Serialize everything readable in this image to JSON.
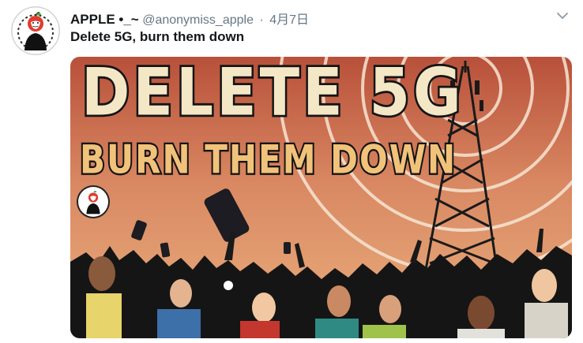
{
  "tweet": {
    "display_name": "APPLE •_~",
    "handle": "@anonymiss_apple",
    "separator": "·",
    "date": "4月7日",
    "text": "Delete 5G, burn them down"
  },
  "media": {
    "title": "DELETE 5G",
    "subtitle": "BURN THEM DOWN"
  },
  "icons": {
    "avatar": "anonymous-mask-apple-icon",
    "menu": "chevron-down-icon"
  },
  "colors": {
    "name": "#14171a",
    "secondary": "#657786",
    "poster_sky_top": "#b8503a",
    "poster_sky_bottom": "#eab07e"
  }
}
